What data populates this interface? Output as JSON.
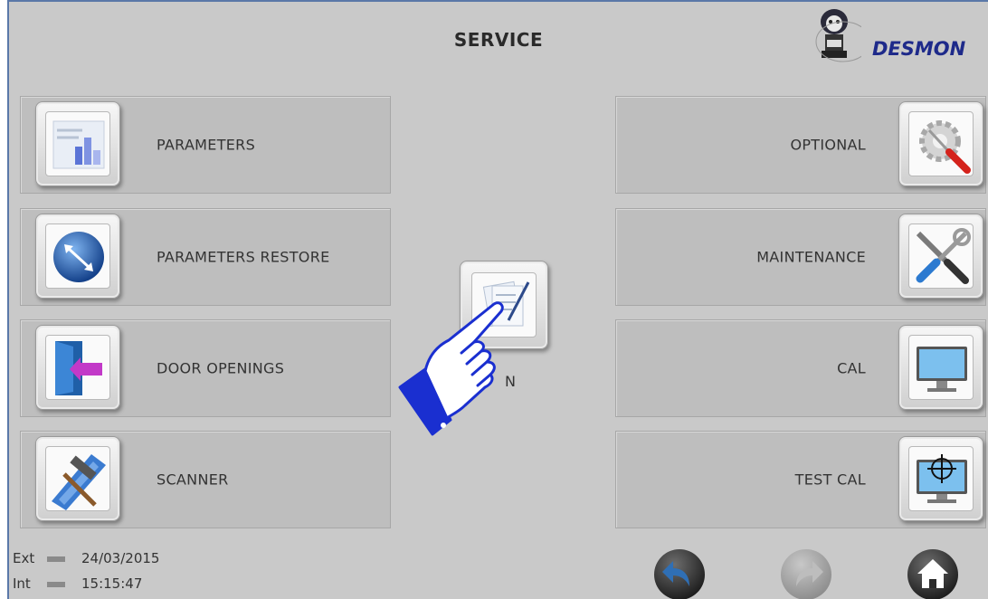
{
  "header": {
    "title": "SERVICE",
    "logo_text": "DESMON"
  },
  "left_menu": [
    {
      "label": "PARAMETERS",
      "icon": "parameters-chart-icon"
    },
    {
      "label": "PARAMETERS RESTORE",
      "icon": "restore-arrows-icon"
    },
    {
      "label": "DOOR OPENINGS",
      "icon": "door-open-icon"
    },
    {
      "label": "SCANNER",
      "icon": "scanner-tools-icon"
    }
  ],
  "right_menu": [
    {
      "label": "OPTIONAL",
      "icon": "gear-screwdriver-icon"
    },
    {
      "label": "MAINTENANCE",
      "icon": "wrench-screwdriver-icon"
    },
    {
      "label": "CAL",
      "icon": "monitor-icon"
    },
    {
      "label": "TEST CAL",
      "icon": "crosshair-monitor-icon"
    }
  ],
  "center": {
    "label": "N",
    "icon": "document-edit-icon"
  },
  "status": {
    "ext_label": "Ext",
    "int_label": "Int",
    "date": "24/03/2015",
    "time": "15:15:47"
  },
  "nav": {
    "back": "back-arrow-icon",
    "forward": "forward-arrow-icon",
    "home": "home-icon"
  },
  "colors": {
    "background": "#c9c9c9",
    "button": "#bebebe",
    "nav_blue": "#2f6fb5",
    "brand": "#1e2a8a",
    "pointer_hand": "#1a2fd0"
  }
}
